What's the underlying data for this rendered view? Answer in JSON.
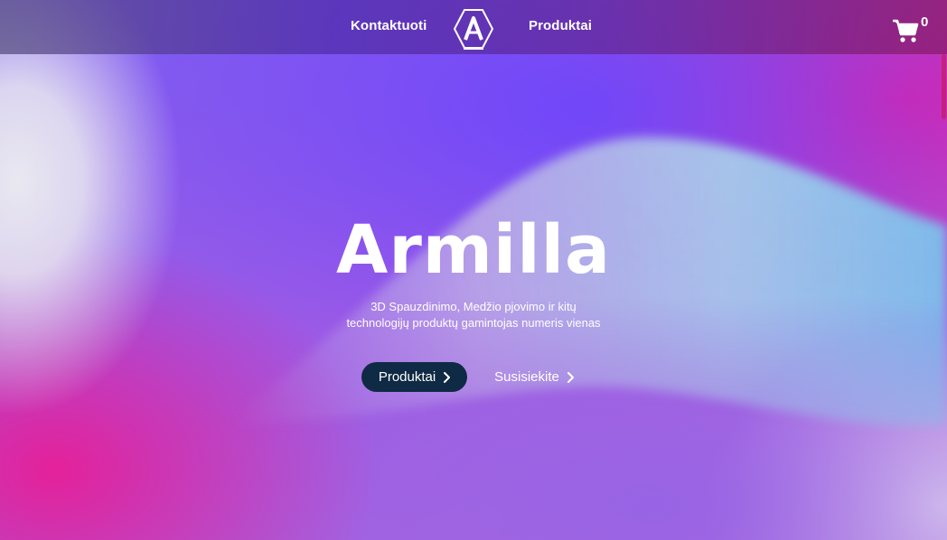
{
  "nav": {
    "contact_label": "Kontaktuoti",
    "products_label": "Produktai",
    "logo_icon": "armilla-hexagon-logo-icon",
    "cart_icon": "shopping-cart-icon",
    "cart_count": "0"
  },
  "hero": {
    "title": "Armilla",
    "subtitle": "3D Spauzdinimo, Medžio pjovimo ir kitų technologijų produktų gamintojas numeris vienas",
    "primary_button": "Produktai",
    "secondary_button": "Susisiekite",
    "button_icon": "chevron-right-icon"
  },
  "colors": {
    "primary_button_bg": "#0f2a44",
    "accent_purple": "#6b4cf0",
    "accent_pink": "#e61e9a",
    "accent_blue": "#7ec8ec"
  }
}
